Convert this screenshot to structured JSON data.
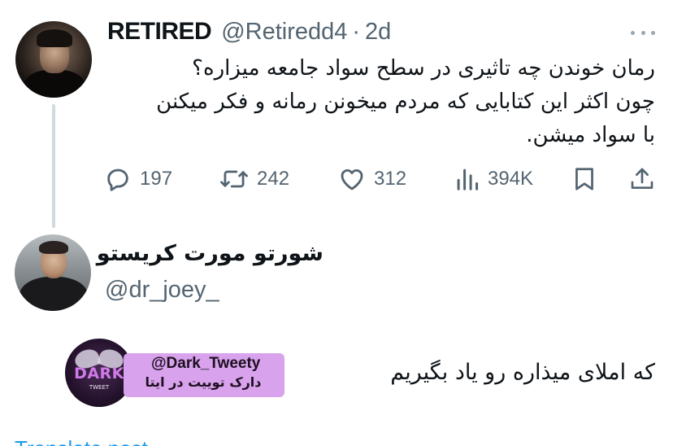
{
  "parent_tweet": {
    "display_name": "RETIRED",
    "handle": "@Retiredd4",
    "separator": "·",
    "time": "2d",
    "text_lines": [
      "رمان خوندن چه تاثیری در سطح سواد جامعه میزاره؟",
      "چون اکثر این کتابایی که مردم میخونن رمانه و فکر میکنن",
      "با سواد میشن."
    ],
    "actions": {
      "replies": "197",
      "retweets": "242",
      "likes": "312",
      "views": "394K"
    }
  },
  "reply_tweet": {
    "display_name": "شورتو مورت کریستو",
    "handle": "@dr_joey_",
    "text": "که املای میذاره رو یاد بگیریم",
    "translate_link": "Translate post"
  },
  "channel_badge": {
    "logo_text": "DARK",
    "logo_subtext": "TWEET",
    "line1": "@Dark_Tweety",
    "line2": "دارک توییت در ایتا"
  },
  "colors": {
    "text_primary": "#0f1419",
    "text_secondary": "#536471",
    "link": "#1d9bf0",
    "thread_line": "#cfd9de",
    "badge_bg": "#d9a2ec"
  },
  "icons": [
    "more-icon",
    "reply-icon",
    "retweet-icon",
    "like-icon",
    "views-icon",
    "bookmark-icon",
    "share-icon"
  ]
}
